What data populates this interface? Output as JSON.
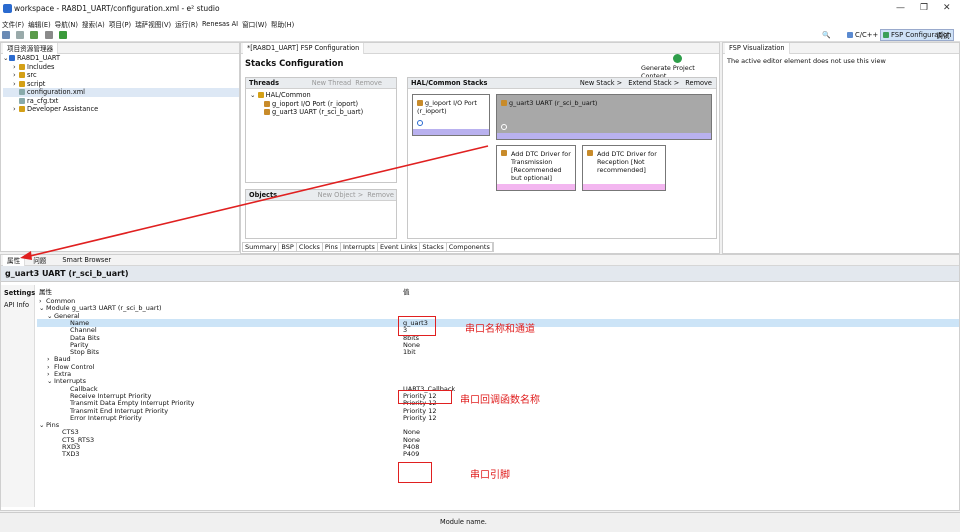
{
  "window": {
    "title": "workspace - RA8D1_UART/configuration.xml - e² studio",
    "minimize": "—",
    "restore": "❐",
    "close": "✕"
  },
  "menu": [
    "文件(F)",
    "编辑(E)",
    "导航(N)",
    "搜索(A)",
    "项目(P)",
    "瑞萨视图(V)",
    "运行(R)",
    "Renesas AI",
    "窗口(W)",
    "帮助(H)"
  ],
  "perspectives": {
    "cpp": "C/C++",
    "fsp": "FSP Configuration",
    "debug": "调试"
  },
  "project_explorer": {
    "tab": "项目资源管理器",
    "items": [
      {
        "label": "RA8D1_UART",
        "indent": 0,
        "prefix": "⌄"
      },
      {
        "label": "Includes",
        "indent": 1,
        "prefix": "›"
      },
      {
        "label": "src",
        "indent": 1,
        "prefix": "›"
      },
      {
        "label": "script",
        "indent": 1,
        "prefix": "›"
      },
      {
        "label": "configuration.xml",
        "indent": 1,
        "prefix": ""
      },
      {
        "label": "ra_cfg.txt",
        "indent": 1,
        "prefix": ""
      },
      {
        "label": "Developer Assistance",
        "indent": 1,
        "prefix": "›"
      }
    ]
  },
  "editor": {
    "tab": "*[RA8D1_UART] FSP Configuration",
    "heading": "Stacks Configuration",
    "generate": "Generate Project Content",
    "threads": {
      "title": "Threads",
      "new_thread": "New Thread",
      "remove": "Remove",
      "group": "HAL/Common",
      "items": [
        "g_ioport I/O Port (r_ioport)",
        "g_uart3 UART (r_sci_b_uart)"
      ]
    },
    "stacks": {
      "title": "HAL/Common Stacks",
      "new_stack": "New Stack >",
      "extend_stack": "Extend Stack >",
      "remove": "Remove"
    },
    "cards": {
      "ioport": "g_ioport I/O Port (r_ioport)",
      "uart": "g_uart3 UART (r_sci_b_uart)",
      "dtc_tx": "Add DTC Driver for Transmission [Recommended but optional]",
      "dtc_rx": "Add DTC Driver for Reception [Not recommended]"
    },
    "objects": {
      "title": "Objects",
      "new_object": "New Object >",
      "remove": "Remove"
    },
    "bottom_tabs": [
      "Summary",
      "BSP",
      "Clocks",
      "Pins",
      "Interrupts",
      "Event Links",
      "Stacks",
      "Components"
    ]
  },
  "fsp_visualization": {
    "tab": "FSP Visualization",
    "message": "The active editor element does not use this view"
  },
  "properties": {
    "tabs": [
      "属性",
      "问题",
      "Smart Browser"
    ],
    "title": "g_uart3 UART (r_sci_b_uart)",
    "side_tabs": [
      "Settings",
      "API Info"
    ],
    "col_prop": "属性",
    "col_val": "值",
    "rows": [
      {
        "k": "Common",
        "v": "",
        "i": 0,
        "p": "›"
      },
      {
        "k": "Module g_uart3 UART (r_sci_b_uart)",
        "v": "",
        "i": 0,
        "p": "⌄"
      },
      {
        "k": "General",
        "v": "",
        "i": 1,
        "p": "⌄"
      },
      {
        "k": "Name",
        "v": "g_uart3",
        "i": 3,
        "p": ""
      },
      {
        "k": "Channel",
        "v": "3",
        "i": 3,
        "p": ""
      },
      {
        "k": "Data Bits",
        "v": "8bits",
        "i": 3,
        "p": ""
      },
      {
        "k": "Parity",
        "v": "None",
        "i": 3,
        "p": ""
      },
      {
        "k": "Stop Bits",
        "v": "1bit",
        "i": 3,
        "p": ""
      },
      {
        "k": "Baud",
        "v": "",
        "i": 1,
        "p": "›"
      },
      {
        "k": "Flow Control",
        "v": "",
        "i": 1,
        "p": "›"
      },
      {
        "k": "Extra",
        "v": "",
        "i": 1,
        "p": "›"
      },
      {
        "k": "Interrupts",
        "v": "",
        "i": 1,
        "p": "⌄"
      },
      {
        "k": "Callback",
        "v": "UART3_Callback",
        "i": 3,
        "p": ""
      },
      {
        "k": "Receive Interrupt Priority",
        "v": "Priority 12",
        "i": 3,
        "p": ""
      },
      {
        "k": "Transmit Data Empty Interrupt Priority",
        "v": "Priority 12",
        "i": 3,
        "p": ""
      },
      {
        "k": "Transmit End Interrupt Priority",
        "v": "Priority 12",
        "i": 3,
        "p": ""
      },
      {
        "k": "Error Interrupt Priority",
        "v": "Priority 12",
        "i": 3,
        "p": ""
      },
      {
        "k": "Pins",
        "v": "",
        "i": 0,
        "p": "⌄"
      },
      {
        "k": "CTS3",
        "v": "None",
        "i": 2,
        "p": ""
      },
      {
        "k": "CTS_RTS3",
        "v": "None",
        "i": 2,
        "p": ""
      },
      {
        "k": "RXD3",
        "v": "P408",
        "i": 2,
        "p": ""
      },
      {
        "k": "TXD3",
        "v": "P409",
        "i": 2,
        "p": ""
      }
    ]
  },
  "annotations": {
    "name_channel": "串口名称和通道",
    "callback": "串口回调函数名称",
    "pins": "串口引脚"
  },
  "status": {
    "text": "Module name."
  },
  "colors": {
    "red": "#e02020",
    "accent": "#2a6acf",
    "selected_row": "#cce4f7"
  }
}
